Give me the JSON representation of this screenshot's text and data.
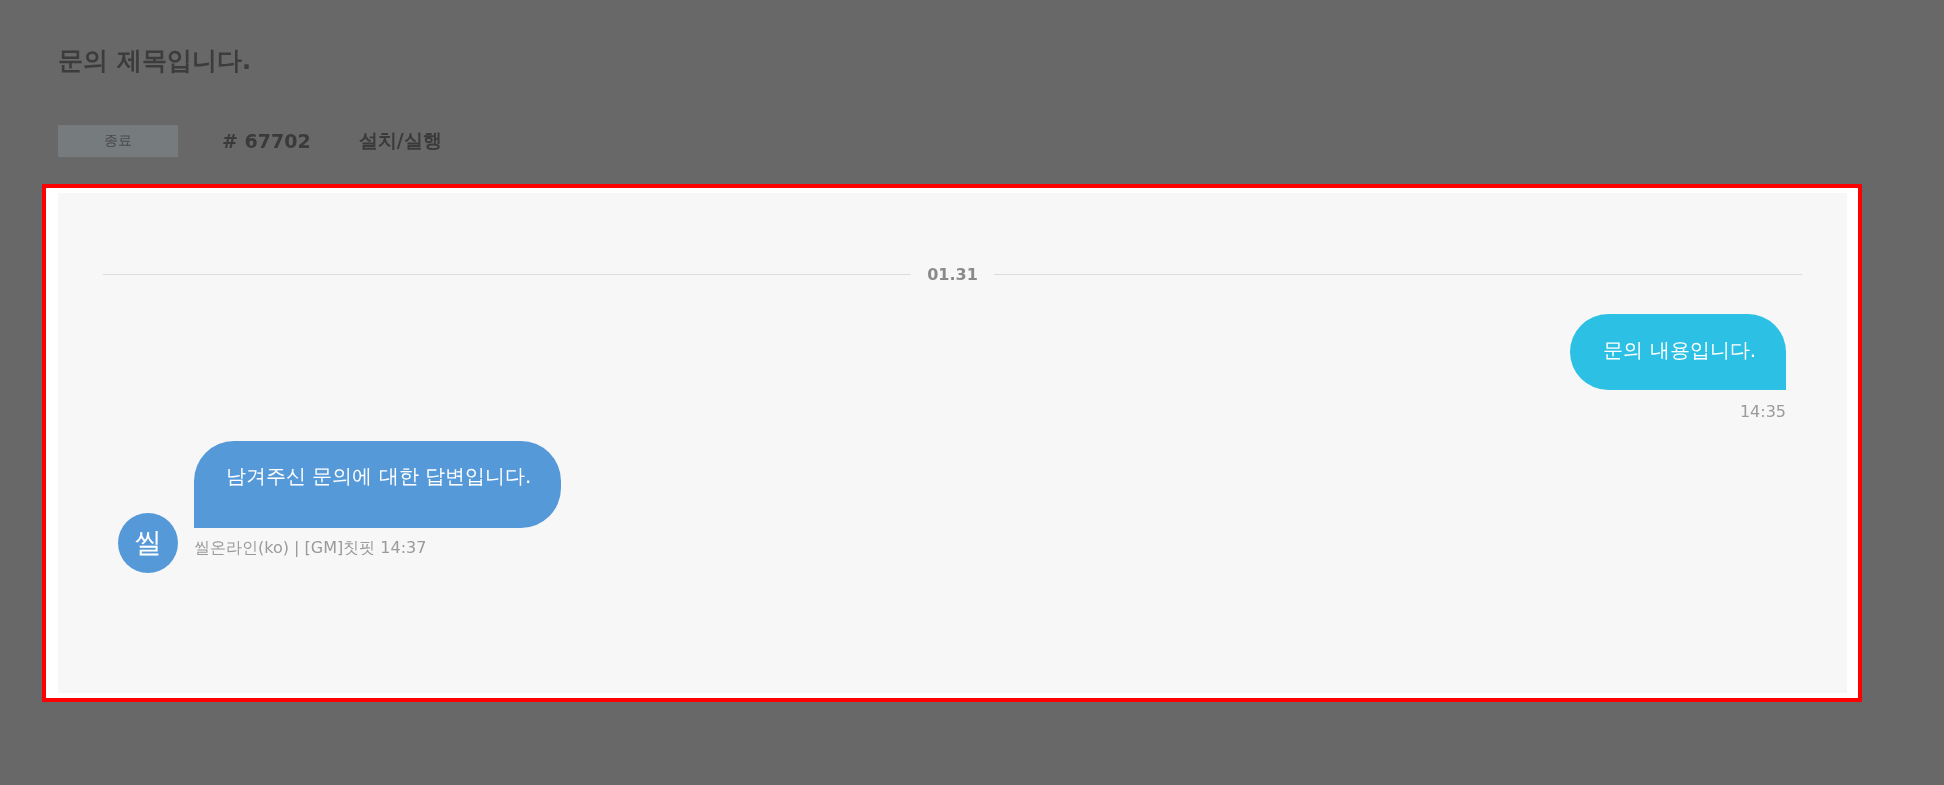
{
  "title": "문의 제목입니다.",
  "ticket": {
    "status": "종료",
    "number": "# 67702",
    "category": "설치/실행"
  },
  "date_divider": "01.31",
  "messages": [
    {
      "kind": "sent",
      "text": "문의 내용입니다.",
      "time": "14:35"
    },
    {
      "kind": "received",
      "text": "남겨주신 문의에 대한 답변입니다.",
      "avatar": "씰",
      "sender": "씰온라인(ko) | [GM]칫핏",
      "time": "14:37"
    }
  ]
}
